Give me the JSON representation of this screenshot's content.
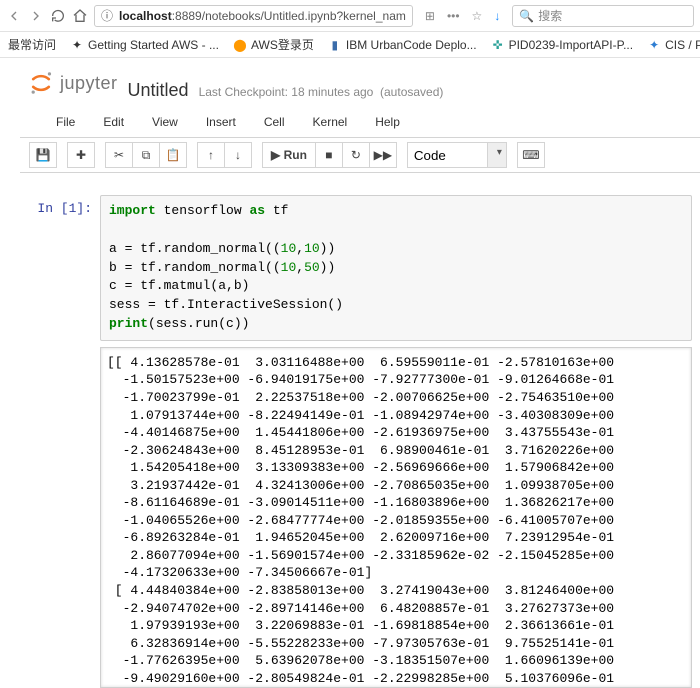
{
  "browser": {
    "url_host": "localhost",
    "url_rest": ":8889/notebooks/Untitled.ipynb?kernel_nam",
    "search_placeholder": "搜索"
  },
  "bookmarks": {
    "most": "最常访问",
    "aws": "Getting Started AWS - ...",
    "awslogin": "AWS登录页",
    "ibm": "IBM UrbanCode Deplo...",
    "pid": "PID0239-ImportAPI-P...",
    "cis": "CIS / PBC - Agile Boar"
  },
  "notebook": {
    "logo_text": "jupyter",
    "title": "Untitled",
    "checkpoint": "Last Checkpoint: 18 minutes ago",
    "autosave": "(autosaved)"
  },
  "menus": {
    "file": "File",
    "edit": "Edit",
    "view": "View",
    "insert": "Insert",
    "cell": "Cell",
    "kernel": "Kernel",
    "help": "Help"
  },
  "toolbar": {
    "run": "Run",
    "celltype": "Code"
  },
  "cell": {
    "prompt": "In [1]:",
    "code_raw": "import tensorflow as tf\n\na = tf.random_normal((10,10))\nb = tf.random_normal((10,50))\nc = tf.matmul(a,b)\nsess = tf.InteractiveSession()\nprint(sess.run(c))",
    "output": "[[ 4.13628578e-01  3.03116488e+00  6.59559011e-01 -2.57810163e+00\n  -1.50157523e+00 -6.94019175e+00 -7.92777300e-01 -9.01264668e-01\n  -1.70023799e-01  2.22537518e+00 -2.00706625e+00 -2.75463510e+00\n   1.07913744e+00 -8.22494149e-01 -1.08942974e+00 -3.40308309e+00\n  -4.40146875e+00  1.45441806e+00 -2.61936975e+00  3.43755543e-01\n  -2.30624843e+00  8.45128953e-01  6.98900461e-01  3.71620226e+00\n   1.54205418e+00  3.13309383e+00 -2.56969666e+00  1.57906842e+00\n   3.21937442e-01  4.32413006e+00 -2.70865035e+00  1.09938705e+00\n  -8.61164689e-01 -3.09014511e+00 -1.16803896e+00  1.36826217e+00\n  -1.04065526e+00 -2.68477774e+00 -2.01859355e+00 -6.41005707e+00\n  -6.89263284e-01  1.94652045e+00  2.62009716e+00  7.23912954e-01\n   2.86077094e+00 -1.56901574e+00 -2.33185962e-02 -2.15045285e+00\n  -4.17320633e+00 -7.34506667e-01]\n [ 4.44840384e+00 -2.83858013e+00  3.27419043e+00  3.81246400e+00\n  -2.94074702e+00 -2.89714146e+00  6.48208857e-01  3.27627373e+00\n   1.97939193e+00  3.22069883e-01 -1.69818854e+00  2.36613661e-01\n   6.32836914e+00 -5.55228233e+00 -7.97305763e-01  9.75525141e-01\n  -1.77626395e+00  5.63962078e+00 -3.18351507e+00  1.66096139e+00\n  -9.49029160e+00 -2.80549824e-01 -2.22998285e+00  5.10376096e-01"
  }
}
